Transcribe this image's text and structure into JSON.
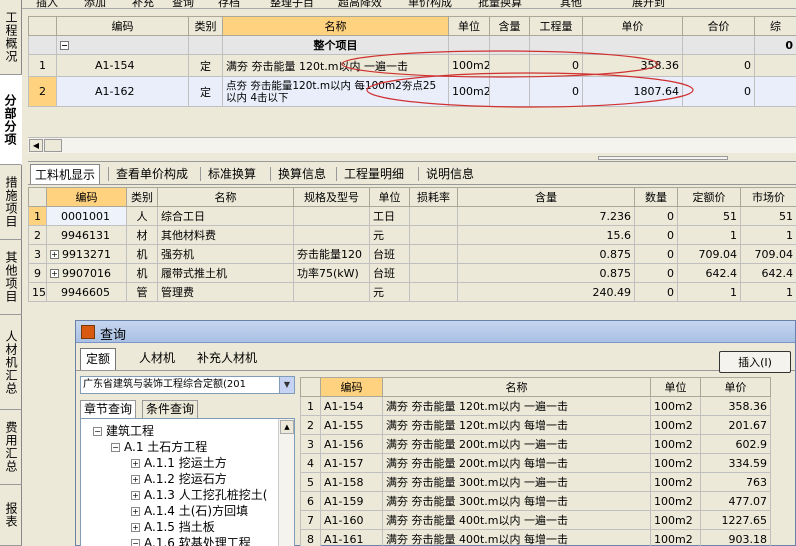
{
  "toolbar": {
    "items": [
      "插入",
      "添加",
      "补充",
      "查询",
      "存档",
      "整理子目",
      "超高降效",
      "单价构成",
      "批量换算",
      "其他",
      "展开到"
    ]
  },
  "left_tabs": [
    "工程概况",
    "分部分项",
    "措施项目",
    "其他项目",
    "人材机汇总",
    "费用汇总",
    "报表"
  ],
  "top_grid": {
    "headers": [
      "",
      "编码",
      "类别",
      "名称",
      "单位",
      "含量",
      "工程量",
      "单价",
      "合价",
      "综"
    ],
    "section": {
      "minus": "−",
      "name": "整个项目",
      "total": "0"
    },
    "rows": [
      {
        "no": "1",
        "code": "A1-154",
        "type": "定",
        "name": "满夯 夯击能量 120t.m以内 一遍一击",
        "unit": "100m2",
        "qty": "0",
        "price": "358.36",
        "total": "0"
      },
      {
        "no": "2",
        "code": "A1-162",
        "type": "定",
        "name": "点夯 夯击能量120t.m以内 每100m2夯点25以内 4击以下",
        "unit": "100m2",
        "qty": "0",
        "price": "1807.64",
        "total": "0"
      }
    ]
  },
  "bottom_tabs": [
    "工料机显示",
    "查看单价构成",
    "标准换算",
    "换算信息",
    "工程量明细",
    "说明信息"
  ],
  "mid_grid": {
    "headers": [
      "",
      "编码",
      "类别",
      "名称",
      "规格及型号",
      "单位",
      "损耗率",
      "含量",
      "数量",
      "定额价",
      "市场价"
    ],
    "rows": [
      {
        "no": "1",
        "expand": "",
        "code": "0001001",
        "type": "人",
        "name": "综合工日",
        "spec": "",
        "unit": "工日",
        "loss": "",
        "content": "7.236",
        "qty": "0",
        "base": "51",
        "market": "51"
      },
      {
        "no": "2",
        "expand": "",
        "code": "9946131",
        "type": "材",
        "name": "其他材料费",
        "spec": "",
        "unit": "元",
        "loss": "",
        "content": "15.6",
        "qty": "0",
        "base": "1",
        "market": "1"
      },
      {
        "no": "3",
        "expand": "+",
        "code": "9913271",
        "type": "机",
        "name": "强夯机",
        "spec": "夯击能量120",
        "unit": "台班",
        "loss": "",
        "content": "0.875",
        "qty": "0",
        "base": "709.04",
        "market": "709.04"
      },
      {
        "no": "9",
        "expand": "+",
        "code": "9907016",
        "type": "机",
        "name": "履带式推土机",
        "spec": "功率75(kW)",
        "unit": "台班",
        "loss": "",
        "content": "0.875",
        "qty": "0",
        "base": "642.4",
        "market": "642.4"
      },
      {
        "no": "15",
        "expand": "",
        "code": "9946605",
        "type": "管",
        "name": "管理费",
        "spec": "",
        "unit": "元",
        "loss": "",
        "content": "240.49",
        "qty": "0",
        "base": "1",
        "market": "1"
      }
    ]
  },
  "dialog": {
    "title": "查询",
    "tabs": [
      "定额",
      "人材机",
      "补充人材机"
    ],
    "insert_label": "插入(I)",
    "quota_select": "广东省建筑与装饰工程综合定额(201",
    "sub_tabs": [
      "章节查询",
      "条件查询"
    ],
    "tree": [
      {
        "level": 0,
        "box": "−",
        "label": "建筑工程"
      },
      {
        "level": 1,
        "box": "−",
        "label": "A.1 土石方工程"
      },
      {
        "level": 2,
        "box": "+",
        "label": "A.1.1 挖运土方"
      },
      {
        "level": 2,
        "box": "+",
        "label": "A.1.2 挖运石方"
      },
      {
        "level": 2,
        "box": "+",
        "label": "A.1.3 人工挖孔桩挖土("
      },
      {
        "level": 2,
        "box": "+",
        "label": "A.1.4 土(石)方回填"
      },
      {
        "level": 2,
        "box": "+",
        "label": "A.1.5 挡土板"
      },
      {
        "level": 2,
        "box": "−",
        "label": "A.1.6 软基处理工程"
      }
    ],
    "grid": {
      "headers": [
        "",
        "编码",
        "名称",
        "单位",
        "单价"
      ],
      "rows": [
        {
          "no": "1",
          "code": "A1-154",
          "name": "满夯 夯击能量 120t.m以内 一遍一击",
          "unit": "100m2",
          "price": "358.36"
        },
        {
          "no": "2",
          "code": "A1-155",
          "name": "满夯 夯击能量 120t.m以内 每增一击",
          "unit": "100m2",
          "price": "201.67"
        },
        {
          "no": "3",
          "code": "A1-156",
          "name": "满夯 夯击能量 200t.m以内 一遍一击",
          "unit": "100m2",
          "price": "602.9"
        },
        {
          "no": "4",
          "code": "A1-157",
          "name": "满夯 夯击能量 200t.m以内 每增一击",
          "unit": "100m2",
          "price": "334.59"
        },
        {
          "no": "5",
          "code": "A1-158",
          "name": "满夯 夯击能量 300t.m以内 一遍一击",
          "unit": "100m2",
          "price": "763"
        },
        {
          "no": "6",
          "code": "A1-159",
          "name": "满夯 夯击能量 300t.m以内 每增一击",
          "unit": "100m2",
          "price": "477.07"
        },
        {
          "no": "7",
          "code": "A1-160",
          "name": "满夯 夯击能量 400t.m以内 一遍一击",
          "unit": "100m2",
          "price": "1227.65"
        },
        {
          "no": "8",
          "code": "A1-161",
          "name": "满夯 夯击能量 400t.m以内 每增一击",
          "unit": "100m2",
          "price": "903.18"
        }
      ]
    }
  },
  "colors": {
    "highlight": "#ffd280",
    "annotation": "#d03030",
    "chrome": "#ece9d8"
  }
}
